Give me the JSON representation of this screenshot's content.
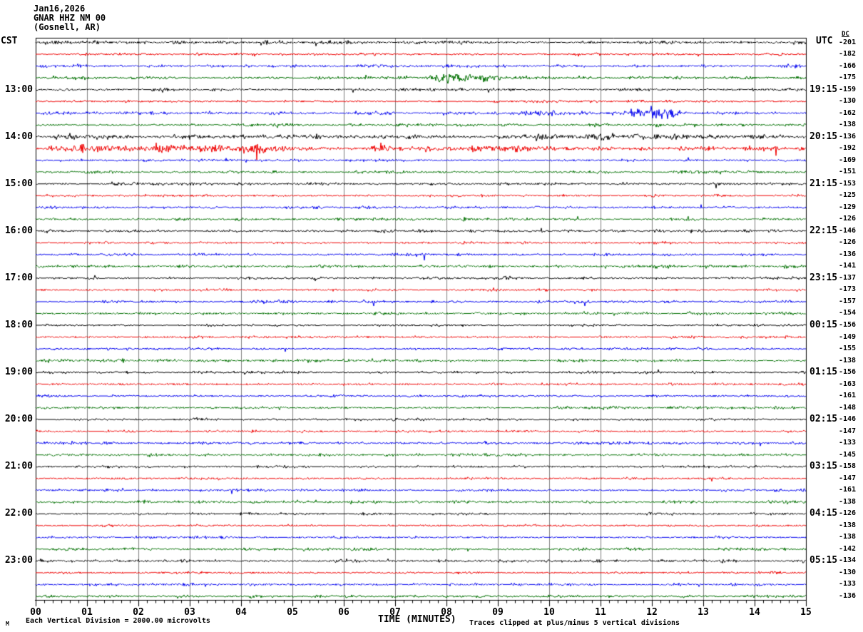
{
  "title": {
    "date": "Jan16,2026",
    "station": "GNAR HHZ NM 00",
    "location": "(Gosnell, AR)"
  },
  "axes": {
    "left_label": "CST",
    "right_label": "UTC",
    "dc_header": "DC",
    "x_title": "TIME (MINUTES)",
    "x_tick_labels": [
      "00",
      "01",
      "02",
      "03",
      "04",
      "05",
      "06",
      "07",
      "08",
      "09",
      "10",
      "11",
      "12",
      "13",
      "14",
      "15"
    ],
    "x_range_minutes": [
      0,
      15
    ],
    "minor_ticks_per_minute": 6,
    "row_duration_minutes": 15,
    "hour_label_every_n_rows": 4
  },
  "footer": {
    "scale_note": "Each Vertical Division = 2000.00 microvolts",
    "clip_note": "Traces clipped at plus/minus 5 vertical divisions",
    "corner_mark": "M"
  },
  "colors": {
    "trace_cycle": [
      "#000000",
      "#f00000",
      "#0000f0",
      "#007000"
    ],
    "grid": "#808080",
    "border": "#000000",
    "background": "#ffffff"
  },
  "chart_data": {
    "type": "line",
    "subtype": "helicorder-seismogram",
    "microvolts_per_division": 2000.0,
    "clip_divisions": 5,
    "row_fields": [
      "cst_start",
      "cst_label",
      "utc_label",
      "dc_offset",
      "color_index",
      "noise_amp_px",
      "events [start_min,end_min,amp_px]",
      "spikes [minute,amp_px,sign]"
    ],
    "rows": [
      [
        "12:00",
        null,
        null,
        -201,
        0,
        1.8,
        [
          [
            4.0,
            6.8,
            2.4
          ]
        ],
        []
      ],
      [
        "12:15",
        null,
        null,
        -182,
        1,
        1.3,
        [
          [
            0.8,
            1.6,
            1.8
          ]
        ],
        []
      ],
      [
        "12:30",
        null,
        null,
        -166,
        2,
        1.5,
        [
          [
            3.8,
            5.2,
            2.0
          ],
          [
            9.5,
            11.2,
            1.8
          ]
        ],
        []
      ],
      [
        "12:45",
        null,
        null,
        -175,
        3,
        1.5,
        [
          [
            6.9,
            7.5,
            2.5
          ],
          [
            7.5,
            9.2,
            7.0
          ],
          [
            9.2,
            10.6,
            2.2
          ]
        ],
        []
      ],
      [
        "13:00",
        "13:00",
        "19:15",
        -159,
        0,
        1.5,
        [],
        []
      ],
      [
        "13:15",
        null,
        null,
        -130,
        1,
        1.2,
        [
          [
            11.2,
            15.0,
            1.8
          ]
        ],
        []
      ],
      [
        "13:30",
        null,
        null,
        -162,
        2,
        1.5,
        [
          [
            7.8,
            11.4,
            2.6
          ],
          [
            11.4,
            12.7,
            7.0
          ],
          [
            12.7,
            15.0,
            2.6
          ]
        ],
        []
      ],
      [
        "13:45",
        null,
        null,
        -138,
        3,
        1.6,
        [],
        []
      ],
      [
        "14:00",
        "14:00",
        "20:15",
        -136,
        0,
        2.4,
        [
          [
            8.8,
            13.7,
            3.4
          ],
          [
            13.7,
            14.7,
            5.5
          ],
          [
            14.7,
            15.0,
            3.0
          ]
        ],
        []
      ],
      [
        "14:15",
        null,
        null,
        -192,
        1,
        2.2,
        [
          [
            0.0,
            5.8,
            5.5
          ],
          [
            5.8,
            12.0,
            3.4
          ],
          [
            12.0,
            15.0,
            2.4
          ]
        ],
        [
          [
            2.35,
            8,
            1
          ],
          [
            6.72,
            8,
            1
          ],
          [
            14.42,
            10,
            -1
          ]
        ]
      ],
      [
        "14:30",
        null,
        null,
        -169,
        2,
        1.4,
        [],
        []
      ],
      [
        "14:45",
        null,
        null,
        -151,
        3,
        1.5,
        [],
        []
      ],
      [
        "15:00",
        "15:00",
        "21:15",
        -153,
        0,
        1.4,
        [],
        []
      ],
      [
        "15:15",
        null,
        null,
        -125,
        1,
        1.2,
        [],
        []
      ],
      [
        "15:30",
        null,
        null,
        -129,
        2,
        1.4,
        [],
        []
      ],
      [
        "15:45",
        null,
        null,
        -126,
        3,
        1.5,
        [],
        []
      ],
      [
        "16:00",
        "16:00",
        "22:15",
        -146,
        0,
        1.4,
        [],
        []
      ],
      [
        "16:15",
        null,
        null,
        -126,
        1,
        1.2,
        [],
        []
      ],
      [
        "16:30",
        null,
        null,
        -136,
        2,
        1.4,
        [],
        []
      ],
      [
        "16:45",
        null,
        null,
        -141,
        3,
        1.5,
        [
          [
            11.9,
            12.4,
            3.5
          ]
        ],
        []
      ],
      [
        "17:00",
        "17:00",
        "23:15",
        -137,
        0,
        1.3,
        [
          [
            7.5,
            7.95,
            2.3
          ],
          [
            9.05,
            9.6,
            2.3
          ]
        ],
        []
      ],
      [
        "17:15",
        null,
        null,
        -173,
        1,
        1.2,
        [],
        []
      ],
      [
        "17:30",
        null,
        null,
        -157,
        2,
        1.4,
        [],
        []
      ],
      [
        "17:45",
        null,
        null,
        -154,
        3,
        1.5,
        [],
        []
      ],
      [
        "18:00",
        "18:00",
        "00:15",
        -156,
        0,
        1.3,
        [],
        []
      ],
      [
        "18:15",
        null,
        null,
        -149,
        1,
        1.2,
        [],
        []
      ],
      [
        "18:30",
        null,
        null,
        -155,
        2,
        1.3,
        [],
        []
      ],
      [
        "18:45",
        null,
        null,
        -138,
        3,
        1.5,
        [],
        []
      ],
      [
        "19:00",
        "19:00",
        "01:15",
        -156,
        0,
        1.4,
        [],
        []
      ],
      [
        "19:15",
        null,
        null,
        -163,
        1,
        1.2,
        [],
        []
      ],
      [
        "19:30",
        null,
        null,
        -161,
        2,
        1.3,
        [],
        []
      ],
      [
        "19:45",
        null,
        null,
        -148,
        3,
        1.5,
        [],
        []
      ],
      [
        "20:00",
        "20:00",
        "02:15",
        -146,
        0,
        1.3,
        [],
        []
      ],
      [
        "20:15",
        null,
        null,
        -147,
        1,
        1.2,
        [],
        []
      ],
      [
        "20:30",
        null,
        null,
        -133,
        2,
        1.4,
        [
          [
            9.8,
            11.6,
            1.9
          ]
        ],
        []
      ],
      [
        "20:45",
        null,
        null,
        -145,
        3,
        1.5,
        [],
        []
      ],
      [
        "21:00",
        "21:00",
        "03:15",
        -158,
        0,
        1.3,
        [],
        []
      ],
      [
        "21:15",
        null,
        null,
        -147,
        1,
        1.2,
        [],
        []
      ],
      [
        "21:30",
        null,
        null,
        -161,
        2,
        1.3,
        [],
        []
      ],
      [
        "21:45",
        null,
        null,
        -138,
        3,
        1.5,
        [],
        []
      ],
      [
        "22:00",
        "22:00",
        "04:15",
        -126,
        0,
        1.3,
        [],
        []
      ],
      [
        "22:15",
        null,
        null,
        -138,
        1,
        1.2,
        [],
        []
      ],
      [
        "22:30",
        null,
        null,
        -138,
        2,
        1.3,
        [],
        []
      ],
      [
        "22:45",
        null,
        null,
        -142,
        3,
        1.5,
        [],
        []
      ],
      [
        "23:00",
        "23:00",
        "05:15",
        -134,
        0,
        1.4,
        [],
        []
      ],
      [
        "23:15",
        null,
        null,
        -130,
        1,
        1.2,
        [],
        []
      ],
      [
        "23:30",
        null,
        null,
        -133,
        2,
        1.3,
        [],
        []
      ],
      [
        "23:45",
        null,
        null,
        -136,
        3,
        1.5,
        [],
        []
      ]
    ]
  }
}
